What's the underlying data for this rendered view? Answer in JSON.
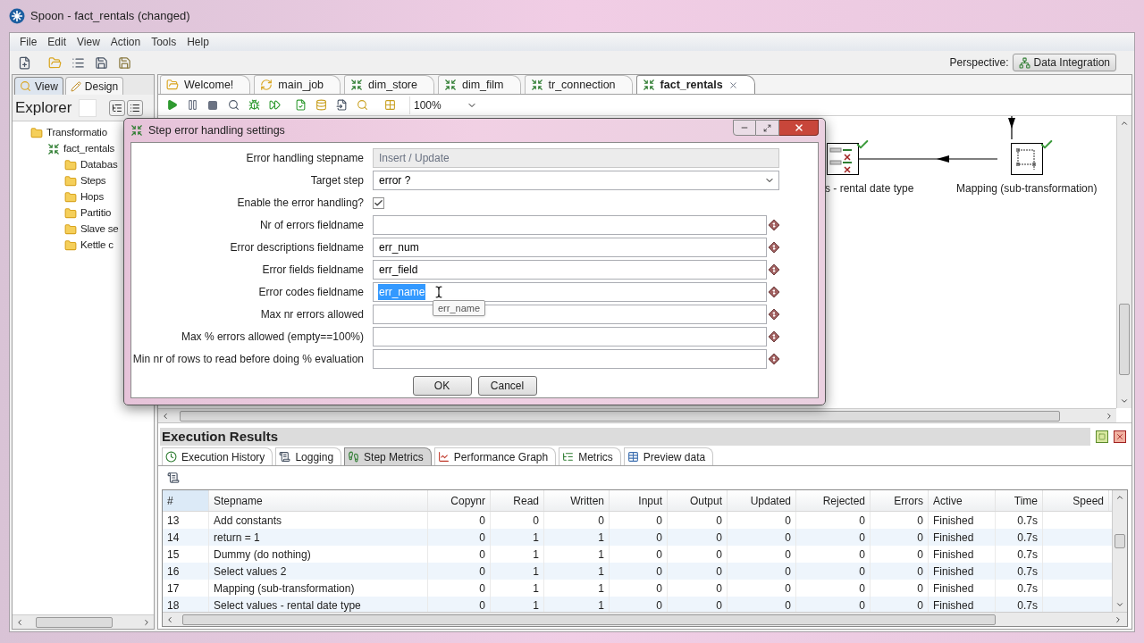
{
  "window": {
    "title": "Spoon - fact_rentals (changed)"
  },
  "menu": [
    "File",
    "Edit",
    "View",
    "Action",
    "Tools",
    "Help"
  ],
  "perspective": {
    "label": "Perspective:",
    "button": "Data Integration"
  },
  "left_panel": {
    "tabs": [
      {
        "label": "View",
        "selected": true
      },
      {
        "label": "Design",
        "selected": false
      }
    ],
    "title": "Explorer",
    "tree": [
      {
        "label": "Transformatio",
        "kind": "folder",
        "children": [
          {
            "label": "fact_rentals",
            "kind": "transformation",
            "children": [
              {
                "label": "Databas",
                "kind": "folder"
              },
              {
                "label": "Steps",
                "kind": "folder"
              },
              {
                "label": "Hops",
                "kind": "folder"
              },
              {
                "label": "Partitio",
                "kind": "folder"
              },
              {
                "label": "Slave se",
                "kind": "folder"
              },
              {
                "label": "Kettle c",
                "kind": "folder"
              }
            ]
          }
        ]
      }
    ]
  },
  "editor_tabs": [
    {
      "label": "Welcome!",
      "kind": "welcome",
      "selected": false
    },
    {
      "label": "main_job",
      "kind": "job",
      "selected": false
    },
    {
      "label": "dim_store",
      "kind": "transformation",
      "selected": false
    },
    {
      "label": "dim_film",
      "kind": "transformation",
      "selected": false
    },
    {
      "label": "tr_connection",
      "kind": "transformation",
      "selected": false
    },
    {
      "label": "fact_rentals",
      "kind": "transformation",
      "selected": true
    }
  ],
  "zoom": "100%",
  "canvas": {
    "nodes": [
      {
        "label": "s - rental date type",
        "kind": "select"
      },
      {
        "label": "Mapping (sub-transformation)",
        "kind": "mapping"
      }
    ]
  },
  "execution_results": {
    "title": "Execution Results",
    "tabs": [
      {
        "label": "Execution History",
        "kind": "history",
        "selected": false
      },
      {
        "label": "Logging",
        "kind": "log",
        "selected": false
      },
      {
        "label": "Step Metrics",
        "kind": "steps",
        "selected": true
      },
      {
        "label": "Performance Graph",
        "kind": "graph",
        "selected": false
      },
      {
        "label": "Metrics",
        "kind": "metrics",
        "selected": false
      },
      {
        "label": "Preview data",
        "kind": "preview",
        "selected": false
      }
    ],
    "table": {
      "columns": [
        "#",
        "Stepname",
        "Copynr",
        "Read",
        "Written",
        "Input",
        "Output",
        "Updated",
        "Rejected",
        "Errors",
        "Active",
        "Time",
        "Speed"
      ],
      "rows": [
        [
          "13",
          "Add constants",
          "0",
          "0",
          "0",
          "0",
          "0",
          "0",
          "0",
          "0",
          "Finished",
          "0.7s"
        ],
        [
          "14",
          "return = 1",
          "0",
          "1",
          "1",
          "0",
          "0",
          "0",
          "0",
          "0",
          "Finished",
          "0.7s"
        ],
        [
          "15",
          "Dummy (do nothing)",
          "0",
          "1",
          "1",
          "0",
          "0",
          "0",
          "0",
          "0",
          "Finished",
          "0.7s"
        ],
        [
          "16",
          "Select values 2",
          "0",
          "1",
          "1",
          "0",
          "0",
          "0",
          "0",
          "0",
          "Finished",
          "0.7s"
        ],
        [
          "17",
          "Mapping (sub-transformation)",
          "0",
          "1",
          "1",
          "0",
          "0",
          "0",
          "0",
          "0",
          "Finished",
          "0.7s"
        ],
        [
          "18",
          "Select values - rental date type",
          "0",
          "1",
          "1",
          "0",
          "0",
          "0",
          "0",
          "0",
          "Finished",
          "0.7s"
        ]
      ]
    }
  },
  "dialog": {
    "title": "Step error handling settings",
    "fields": [
      {
        "label": "Error handling stepname",
        "kind": "text",
        "value": "Insert / Update",
        "disabled": true,
        "highlighted": false
      },
      {
        "label": "Target step",
        "kind": "combo",
        "value": "error ?",
        "disabled": false,
        "highlighted": false
      },
      {
        "label": "Enable the error handling?",
        "kind": "checkbox",
        "checked": true
      },
      {
        "label": "Nr of errors fieldname",
        "kind": "variable",
        "disabled": false
      },
      {
        "label": "Error descriptions fieldname",
        "kind": "variable",
        "value": "err_num",
        "disabled": false,
        "highlighted": false
      },
      {
        "label": "Error fields fieldname",
        "kind": "variable",
        "value": "err_field",
        "disabled": false,
        "highlighted": false
      },
      {
        "label": "Error codes fieldname",
        "kind": "variable",
        "value": "err_name",
        "disabled": false,
        "highlighted": true
      },
      {
        "label": "Max nr errors allowed",
        "kind": "variable",
        "disabled": false
      },
      {
        "label": "Max % errors allowed (empty==100%)",
        "kind": "variable",
        "disabled": false
      },
      {
        "label": "Min nr of rows to read before doing % evaluation",
        "kind": "variable",
        "disabled": false
      }
    ],
    "tooltip": "err_name",
    "buttons": [
      "OK",
      "Cancel"
    ]
  }
}
